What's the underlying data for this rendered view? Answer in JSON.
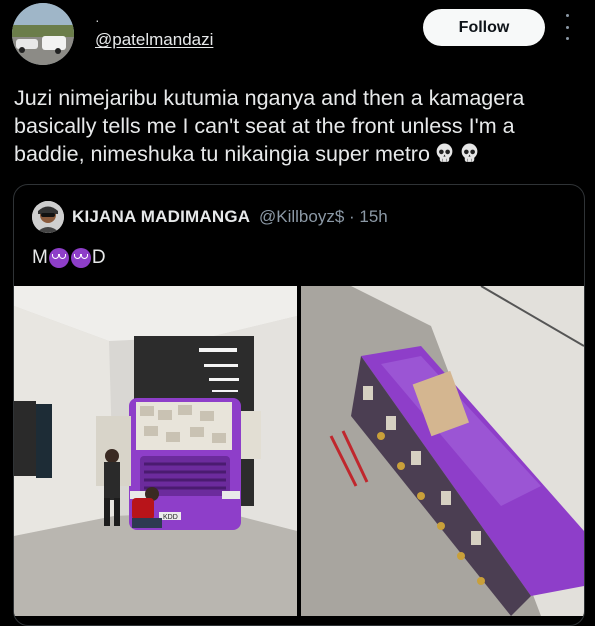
{
  "post": {
    "name_dot": "·",
    "handle": "@patelmandazi",
    "follow_label": "Follow",
    "text": "Juzi nimejaribu kutumia nganya and then a kamagera basically tells me I can't seat at the front unless I'm a baddie, nimeshuka tu nikaingia super metro",
    "text_emoji": [
      "skull-emoji",
      "skull-emoji"
    ]
  },
  "quote": {
    "name": "KIJANA MADIMANGA",
    "handle": "@Killboyz$ · 15h",
    "text_start": "M",
    "text_end": "D",
    "text_emoji": [
      "smiling-imp-emoji",
      "smiling-imp-emoji"
    ],
    "plate": "KDD"
  },
  "colors": {
    "bus_purple": "#8e3ec9",
    "follow_bg": "#f7f9f9"
  }
}
